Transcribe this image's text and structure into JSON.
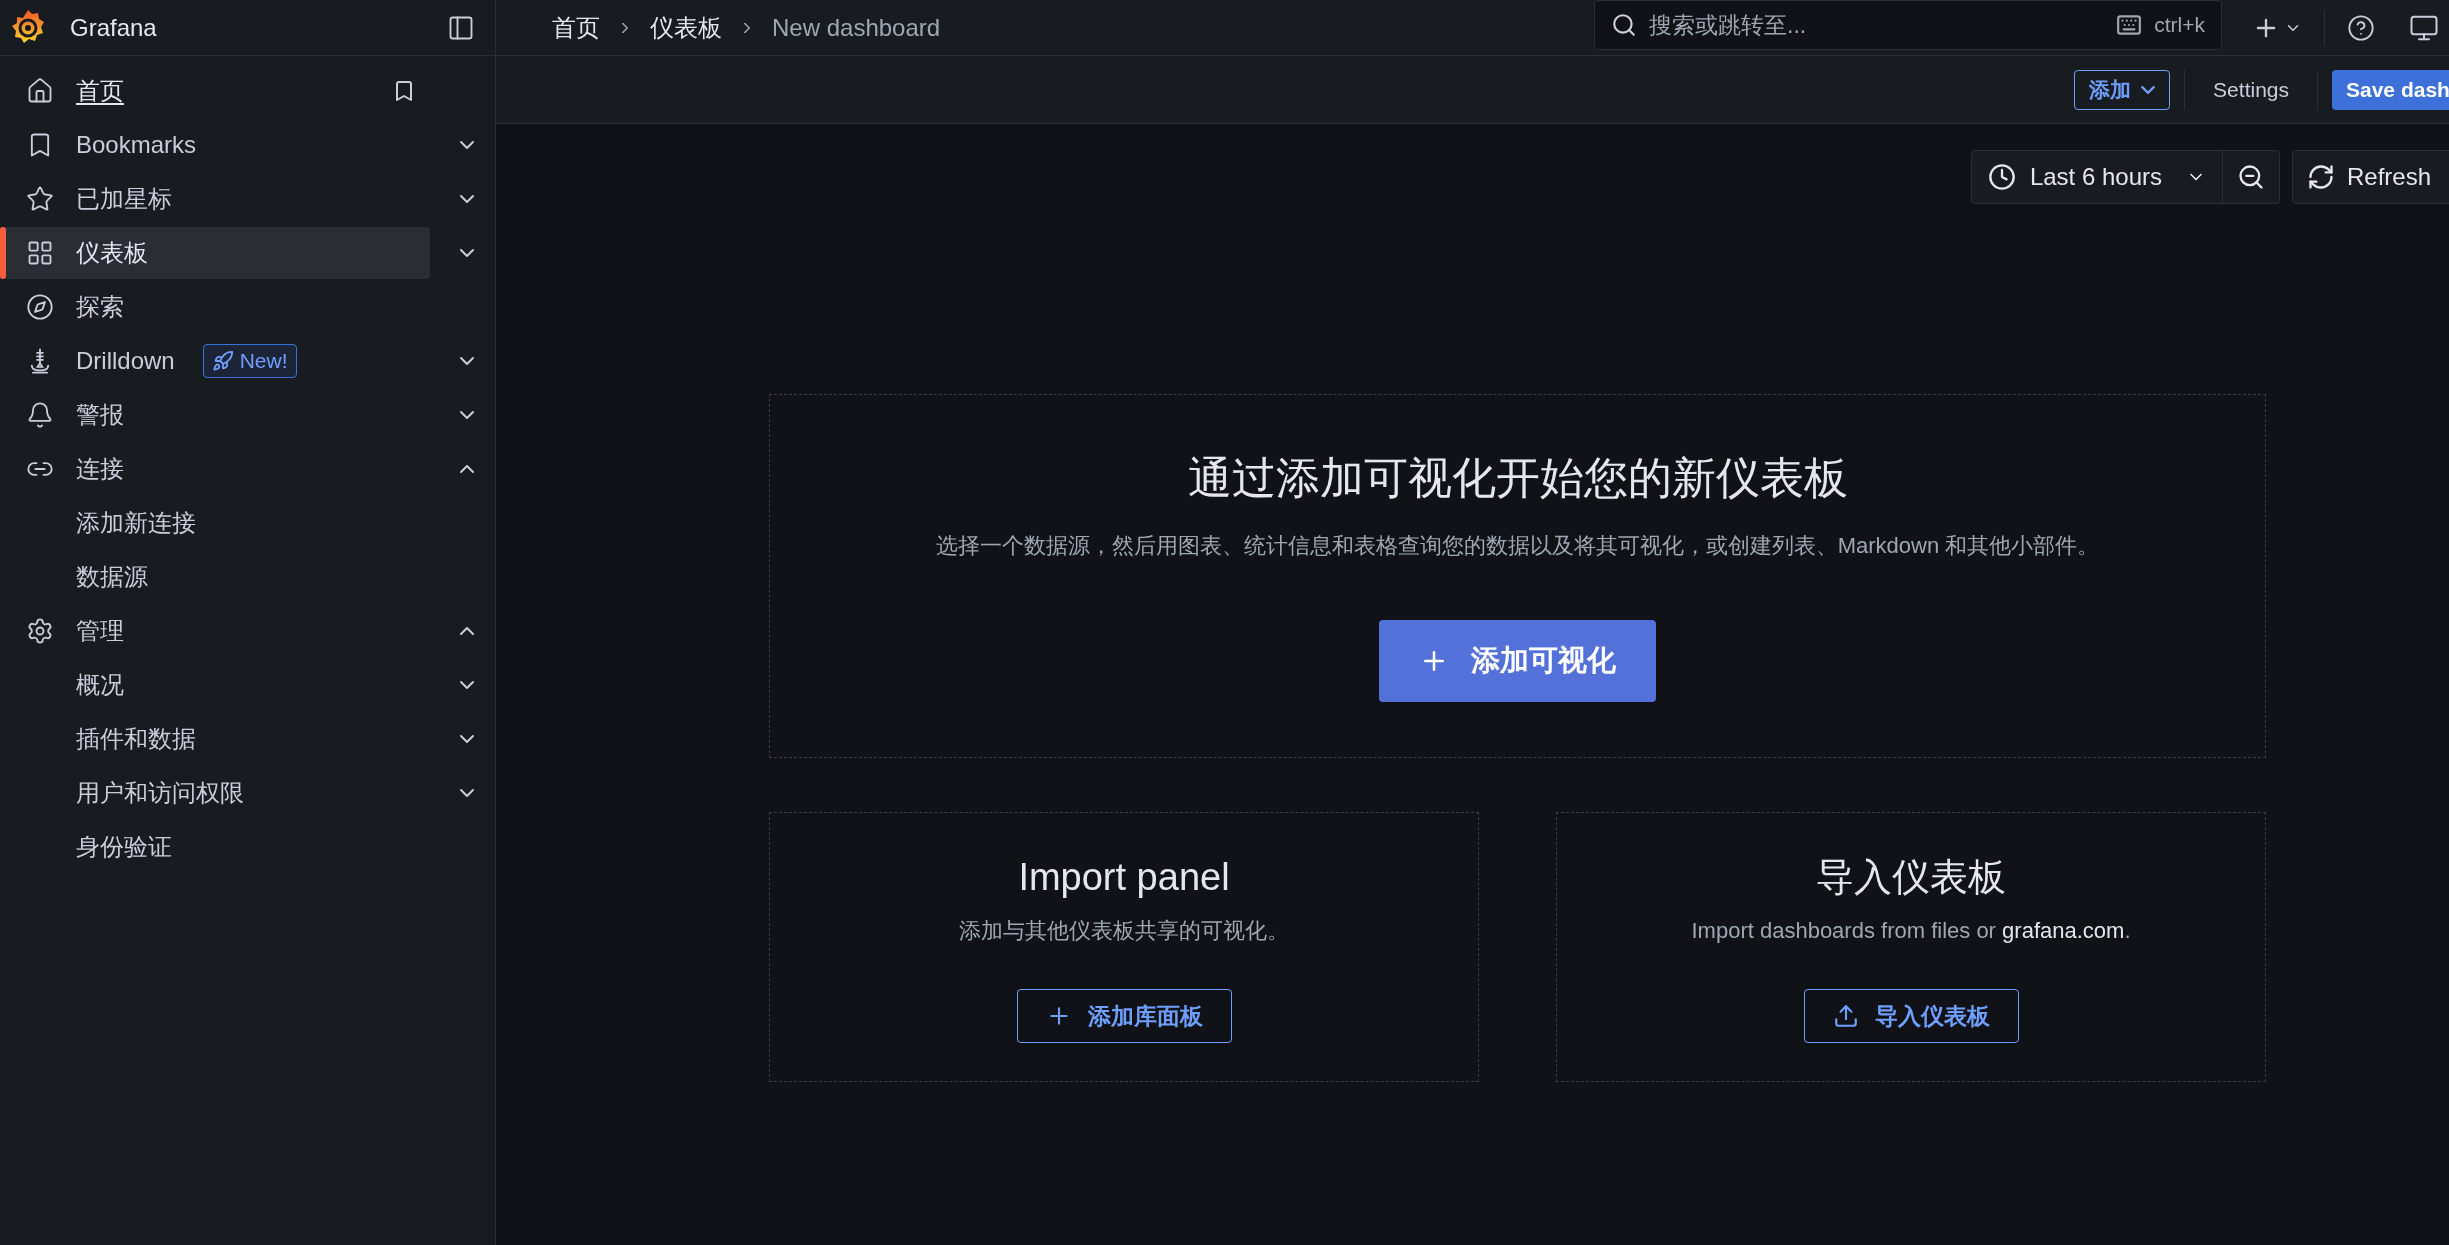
{
  "app": {
    "name": "Grafana"
  },
  "breadcrumbs": [
    {
      "label": "首页",
      "current": false
    },
    {
      "label": "仪表板",
      "current": false
    },
    {
      "label": "New dashboard",
      "current": true
    }
  ],
  "search": {
    "placeholder": "搜索或跳转至...",
    "shortcut": "ctrl+k"
  },
  "sidebar": {
    "items": [
      {
        "label": "首页",
        "kind": "home",
        "selected": false,
        "current": true
      },
      {
        "label": "Bookmarks",
        "kind": "bookmark",
        "selected": false,
        "expanded": false
      },
      {
        "label": "已加星标",
        "kind": "star",
        "selected": false,
        "expanded": false
      },
      {
        "label": "仪表板",
        "kind": "grid",
        "selected": true,
        "expanded": false
      },
      {
        "label": "探索",
        "kind": "compass",
        "selected": false
      },
      {
        "label": "Drilldown",
        "kind": "drill",
        "selected": false,
        "expanded": false,
        "badge": "New!"
      },
      {
        "label": "警报",
        "kind": "bell",
        "selected": false,
        "expanded": false
      },
      {
        "label": "连接",
        "kind": "link",
        "selected": false,
        "expanded": true,
        "children": [
          {
            "label": "添加新连接",
            "selected": false
          },
          {
            "label": "数据源",
            "selected": false
          }
        ]
      },
      {
        "label": "管理",
        "kind": "gear",
        "selected": false,
        "expanded": true,
        "children": [
          {
            "label": "概况",
            "selected": false,
            "expanded": false
          },
          {
            "label": "插件和数据",
            "selected": false,
            "expanded": false
          },
          {
            "label": "用户和访问权限",
            "selected": false,
            "expanded": false
          },
          {
            "label": "身份验证",
            "selected": false
          }
        ]
      }
    ]
  },
  "toolbar": {
    "add": "添加",
    "settings": "Settings",
    "save": "Save dash"
  },
  "time_picker": {
    "range": "Last 6 hours",
    "refresh": "Refresh"
  },
  "empty_state": {
    "title": "通过添加可视化开始您的新仪表板",
    "description": "选择一个数据源，然后用图表、统计信息和表格查询您的数据以及将其可视化，或创建列表、Markdown 和其他小部件。",
    "button": "添加可视化"
  },
  "cards": [
    {
      "kind": "library",
      "title": "Import panel",
      "description": "添加与其他仪表板共享的可视化。",
      "button": "添加库面板"
    },
    {
      "kind": "import",
      "title": "导入仪表板",
      "description": "Import dashboards from files or",
      "link": "grafana.com",
      "after": ".",
      "button": "导入仪表板"
    }
  ]
}
